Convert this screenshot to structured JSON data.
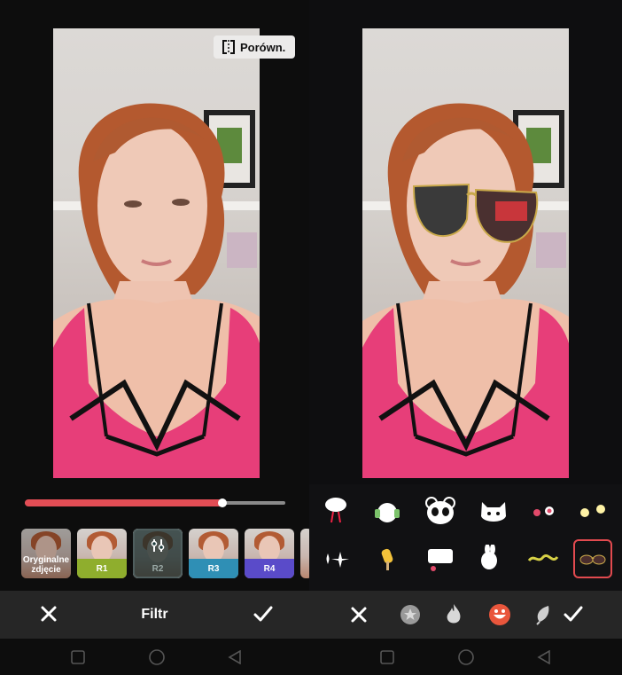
{
  "left": {
    "compare_label": "Porówn.",
    "slider": {
      "value_pct": 76
    },
    "filters": [
      {
        "label": "Oryginalne zdjęcie",
        "band": ""
      },
      {
        "label": "R1",
        "band": "#8fae2d"
      },
      {
        "label": "R2",
        "band": "#1d3b3b",
        "selected": true
      },
      {
        "label": "R3",
        "band": "#2f8fb5"
      },
      {
        "label": "R4",
        "band": "#5a4bc9"
      }
    ],
    "bottom": {
      "title": "Filtr"
    }
  },
  "colors": {
    "accent": "#e34d55",
    "bar": "#262626"
  }
}
